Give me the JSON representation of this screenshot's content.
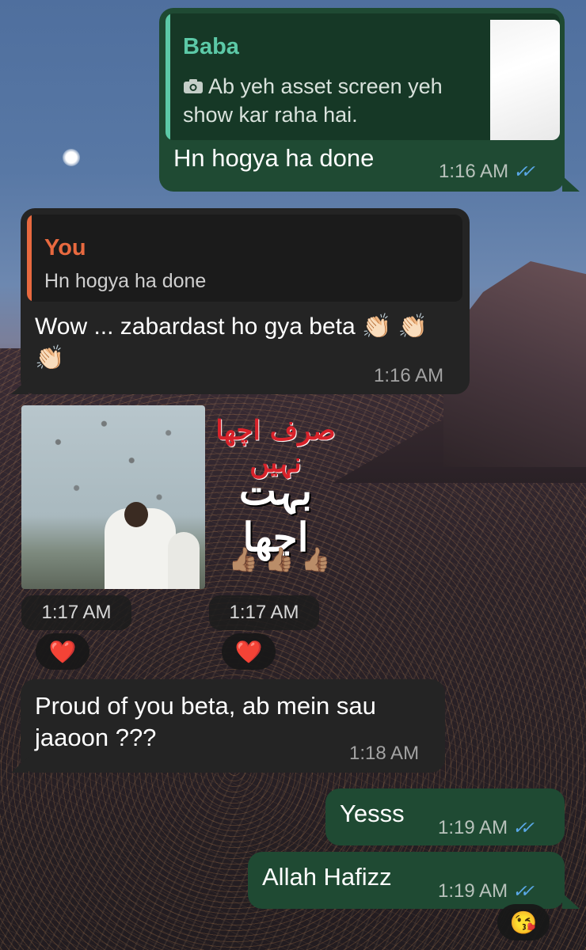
{
  "messages": {
    "m1": {
      "quote_author": "Baba",
      "quote_icon": "camera-icon",
      "quote_text": "Ab yeh asset screen yeh show kar raha hai.",
      "text": "Hn hogya ha done",
      "time": "1:16 AM",
      "status": "read"
    },
    "m2": {
      "quote_author": "You",
      "quote_text": "Hn hogya ha done",
      "text": "Wow ... zabardast ho gya beta 👏🏻 👏🏻 👏🏻",
      "time": "1:16 AM"
    },
    "m3": {
      "time": "1:17 AM",
      "reaction": "❤️"
    },
    "m4": {
      "urdu_line1": "صرف اچھا نہیں",
      "urdu_line2": "بہت اچھا",
      "emojis": "👍🏽 👍🏽 👍🏽",
      "time": "1:17 AM",
      "reaction": "❤️"
    },
    "m5": {
      "text": "Proud of you beta, ab mein sau jaaoon ???",
      "time": "1:18 AM"
    },
    "m6": {
      "text": "Yesss",
      "time": "1:19 AM",
      "status": "read"
    },
    "m7": {
      "text": "Allah Hafizz",
      "time": "1:19 AM",
      "status": "read",
      "reaction": "😘"
    }
  },
  "colors": {
    "outgoing_bubble": "#1f4a33",
    "incoming_bubble": "#242424",
    "quote_author_baba": "#5cc9a7",
    "quote_author_you": "#e8693f",
    "read_ticks": "#5aa8e8"
  }
}
